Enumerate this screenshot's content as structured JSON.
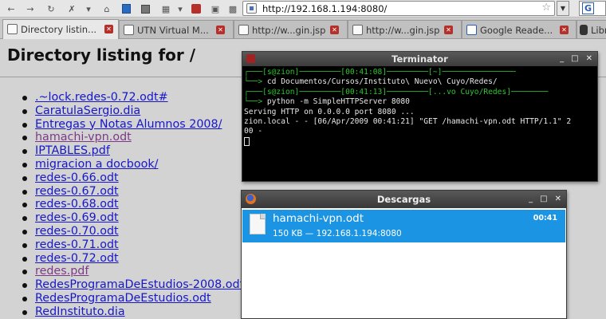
{
  "toolbar": {
    "url": "http://192.168.1.194:8080/",
    "icons": [
      "back-icon",
      "forward-icon",
      "reload-icon",
      "stop-icon",
      "home-icon",
      "bookmark-icon",
      "history-icon",
      "apps-icon",
      "close-red-icon",
      "screen-icon"
    ]
  },
  "tabs": [
    {
      "label": "Directory listin...",
      "active": true
    },
    {
      "label": "UTN Virtual M...",
      "active": false
    },
    {
      "label": "http://w...gin.jsp",
      "active": false
    },
    {
      "label": "http://w...gin.jsp",
      "active": false
    },
    {
      "label": "Google Reade...",
      "active": false
    },
    {
      "label": "Libre",
      "active": false
    }
  ],
  "page": {
    "title": "Directory listing for /",
    "files": [
      {
        "name": ".~lock.redes-0.72.odt#",
        "visited": false
      },
      {
        "name": "CaratulaSergio.dia",
        "visited": false
      },
      {
        "name": "Entregas y Notas Alumnos 2008/",
        "visited": false
      },
      {
        "name": "hamachi-vpn.odt",
        "visited": true
      },
      {
        "name": "IPTABLES.pdf",
        "visited": false
      },
      {
        "name": "migracion a docbook/",
        "visited": false
      },
      {
        "name": "redes-0.66.odt",
        "visited": false
      },
      {
        "name": "redes-0.67.odt",
        "visited": false
      },
      {
        "name": "redes-0.68.odt",
        "visited": false
      },
      {
        "name": "redes-0.69.odt",
        "visited": false
      },
      {
        "name": "redes-0.70.odt",
        "visited": false
      },
      {
        "name": "redes-0.71.odt",
        "visited": false
      },
      {
        "name": "redes-0.72.odt",
        "visited": false
      },
      {
        "name": "redes.pdf",
        "visited": true
      },
      {
        "name": "RedesProgramaDeEstudios-2008.odt",
        "visited": false
      },
      {
        "name": "RedesProgramaDeEstudios.odt",
        "visited": false
      },
      {
        "name": "RedInstituto.dia",
        "visited": false
      }
    ]
  },
  "terminal": {
    "title": "Terminator",
    "prompt1": "[s@zion]─────────[00:41:08]─────────[~]",
    "cmd1": "cd Documentos/Cursos/Instituto\\ Nuevo\\ Cuyo/Redes/",
    "prompt2": "[s@zion]─────────[00:41:13]─────────[...vo Cuyo/Redes]",
    "cmd2": "python -m SimpleHTTPServer 8080",
    "out1": "Serving HTTP on 0.0.0.0 port 8080 ...",
    "out2": "zion.local - - [06/Apr/2009 00:41:21] \"GET /hamachi-vpn.odt HTTP/1.1\" 2",
    "out3": "00 -"
  },
  "downloads": {
    "title": "Descargas",
    "item": {
      "name": "hamachi-vpn.odt",
      "status": "150 KB — 192.168.1.194:8080",
      "time": "00:41"
    }
  },
  "colors": {
    "link": "#1717c9",
    "visited_link": "#7c3a86",
    "terminal_green": "#2fc42f",
    "download_highlight": "#1a94e3"
  }
}
